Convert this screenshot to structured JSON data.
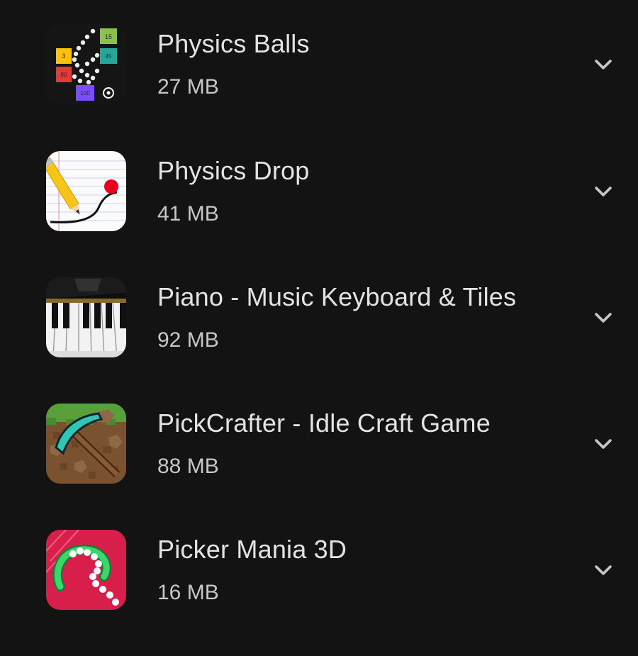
{
  "apps": [
    {
      "name": "Physics Balls",
      "size": "27 MB",
      "icon": "physics-balls-app-icon"
    },
    {
      "name": "Physics Drop",
      "size": "41 MB",
      "icon": "physics-drop-app-icon"
    },
    {
      "name": "Piano - Music Keyboard & Tiles",
      "size": "92 MB",
      "icon": "piano-app-icon"
    },
    {
      "name": "PickCrafter - Idle Craft Game",
      "size": "88 MB",
      "icon": "pickcrafter-app-icon"
    },
    {
      "name": "Picker Mania 3D",
      "size": "16 MB",
      "icon": "picker-mania-app-icon"
    }
  ],
  "icons": {
    "expand": "chevron-down-icon"
  },
  "physics_balls_icon_numbers": [
    "15",
    "3",
    "45",
    "80",
    "100"
  ],
  "colors": {
    "background": "#131313",
    "primary_text": "#e3e3e3",
    "secondary_text": "#c4c7c5",
    "chevron": "#c4c7c5"
  }
}
